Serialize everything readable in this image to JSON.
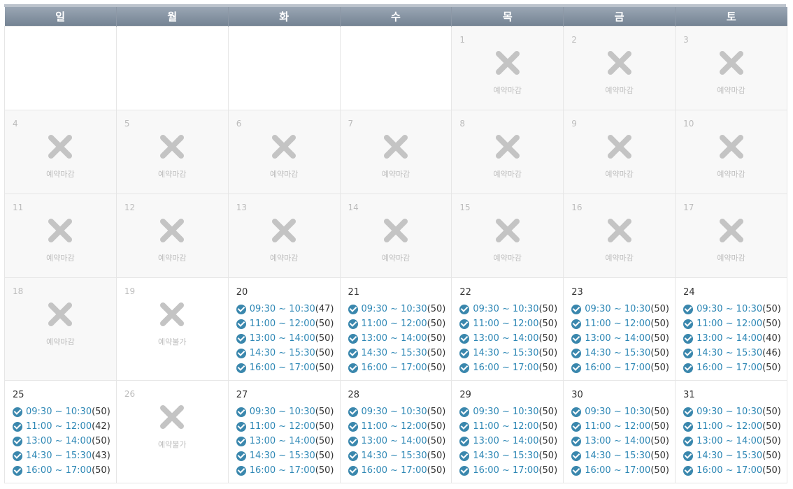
{
  "weekdays": [
    "일",
    "월",
    "화",
    "수",
    "목",
    "금",
    "토"
  ],
  "labels": {
    "closed": "예약마감",
    "unavailable": "예약불가"
  },
  "colors": {
    "header": "#7b8898",
    "slot_link": "#2d87b5",
    "check_icon": "#3a87ad",
    "closed_bg": "#f8f8f8"
  },
  "icons": {
    "closed": "x-mark-icon",
    "available": "check-circle-icon"
  },
  "weeks": [
    [
      {
        "status": "empty"
      },
      {
        "status": "empty"
      },
      {
        "status": "empty"
      },
      {
        "status": "empty"
      },
      {
        "day": "1",
        "status": "closed"
      },
      {
        "day": "2",
        "status": "closed"
      },
      {
        "day": "3",
        "status": "closed"
      }
    ],
    [
      {
        "day": "4",
        "status": "closed"
      },
      {
        "day": "5",
        "status": "closed"
      },
      {
        "day": "6",
        "status": "closed"
      },
      {
        "day": "7",
        "status": "closed"
      },
      {
        "day": "8",
        "status": "closed"
      },
      {
        "day": "9",
        "status": "closed"
      },
      {
        "day": "10",
        "status": "closed"
      }
    ],
    [
      {
        "day": "11",
        "status": "closed"
      },
      {
        "day": "12",
        "status": "closed"
      },
      {
        "day": "13",
        "status": "closed"
      },
      {
        "day": "14",
        "status": "closed"
      },
      {
        "day": "15",
        "status": "closed"
      },
      {
        "day": "16",
        "status": "closed"
      },
      {
        "day": "17",
        "status": "closed"
      }
    ],
    [
      {
        "day": "18",
        "status": "closed"
      },
      {
        "day": "19",
        "status": "unavailable"
      },
      {
        "day": "20",
        "status": "open",
        "slots": [
          {
            "time": "09:30 ~ 10:30",
            "count": "(47)"
          },
          {
            "time": "11:00 ~ 12:00",
            "count": "(50)"
          },
          {
            "time": "13:00 ~ 14:00",
            "count": "(50)"
          },
          {
            "time": "14:30 ~ 15:30",
            "count": "(50)"
          },
          {
            "time": "16:00 ~ 17:00",
            "count": "(50)"
          }
        ]
      },
      {
        "day": "21",
        "status": "open",
        "slots": [
          {
            "time": "09:30 ~ 10:30",
            "count": "(50)"
          },
          {
            "time": "11:00 ~ 12:00",
            "count": "(50)"
          },
          {
            "time": "13:00 ~ 14:00",
            "count": "(50)"
          },
          {
            "time": "14:30 ~ 15:30",
            "count": "(50)"
          },
          {
            "time": "16:00 ~ 17:00",
            "count": "(50)"
          }
        ]
      },
      {
        "day": "22",
        "status": "open",
        "slots": [
          {
            "time": "09:30 ~ 10:30",
            "count": "(50)"
          },
          {
            "time": "11:00 ~ 12:00",
            "count": "(50)"
          },
          {
            "time": "13:00 ~ 14:00",
            "count": "(50)"
          },
          {
            "time": "14:30 ~ 15:30",
            "count": "(50)"
          },
          {
            "time": "16:00 ~ 17:00",
            "count": "(50)"
          }
        ]
      },
      {
        "day": "23",
        "status": "open",
        "slots": [
          {
            "time": "09:30 ~ 10:30",
            "count": "(50)"
          },
          {
            "time": "11:00 ~ 12:00",
            "count": "(50)"
          },
          {
            "time": "13:00 ~ 14:00",
            "count": "(50)"
          },
          {
            "time": "14:30 ~ 15:30",
            "count": "(50)"
          },
          {
            "time": "16:00 ~ 17:00",
            "count": "(50)"
          }
        ]
      },
      {
        "day": "24",
        "status": "open",
        "slots": [
          {
            "time": "09:30 ~ 10:30",
            "count": "(50)"
          },
          {
            "time": "11:00 ~ 12:00",
            "count": "(50)"
          },
          {
            "time": "13:00 ~ 14:00",
            "count": "(40)"
          },
          {
            "time": "14:30 ~ 15:30",
            "count": "(46)"
          },
          {
            "time": "16:00 ~ 17:00",
            "count": "(50)"
          }
        ]
      }
    ],
    [
      {
        "day": "25",
        "status": "open",
        "slots": [
          {
            "time": "09:30 ~ 10:30",
            "count": "(50)"
          },
          {
            "time": "11:00 ~ 12:00",
            "count": "(42)"
          },
          {
            "time": "13:00 ~ 14:00",
            "count": "(50)"
          },
          {
            "time": "14:30 ~ 15:30",
            "count": "(43)"
          },
          {
            "time": "16:00 ~ 17:00",
            "count": "(50)"
          }
        ]
      },
      {
        "day": "26",
        "status": "unavailable"
      },
      {
        "day": "27",
        "status": "open",
        "slots": [
          {
            "time": "09:30 ~ 10:30",
            "count": "(50)"
          },
          {
            "time": "11:00 ~ 12:00",
            "count": "(50)"
          },
          {
            "time": "13:00 ~ 14:00",
            "count": "(50)"
          },
          {
            "time": "14:30 ~ 15:30",
            "count": "(50)"
          },
          {
            "time": "16:00 ~ 17:00",
            "count": "(50)"
          }
        ]
      },
      {
        "day": "28",
        "status": "open",
        "slots": [
          {
            "time": "09:30 ~ 10:30",
            "count": "(50)"
          },
          {
            "time": "11:00 ~ 12:00",
            "count": "(50)"
          },
          {
            "time": "13:00 ~ 14:00",
            "count": "(50)"
          },
          {
            "time": "14:30 ~ 15:30",
            "count": "(50)"
          },
          {
            "time": "16:00 ~ 17:00",
            "count": "(50)"
          }
        ]
      },
      {
        "day": "29",
        "status": "open",
        "slots": [
          {
            "time": "09:30 ~ 10:30",
            "count": "(50)"
          },
          {
            "time": "11:00 ~ 12:00",
            "count": "(50)"
          },
          {
            "time": "13:00 ~ 14:00",
            "count": "(50)"
          },
          {
            "time": "14:30 ~ 15:30",
            "count": "(50)"
          },
          {
            "time": "16:00 ~ 17:00",
            "count": "(50)"
          }
        ]
      },
      {
        "day": "30",
        "status": "open",
        "slots": [
          {
            "time": "09:30 ~ 10:30",
            "count": "(50)"
          },
          {
            "time": "11:00 ~ 12:00",
            "count": "(50)"
          },
          {
            "time": "13:00 ~ 14:00",
            "count": "(50)"
          },
          {
            "time": "14:30 ~ 15:30",
            "count": "(50)"
          },
          {
            "time": "16:00 ~ 17:00",
            "count": "(50)"
          }
        ]
      },
      {
        "day": "31",
        "status": "open",
        "slots": [
          {
            "time": "09:30 ~ 10:30",
            "count": "(50)"
          },
          {
            "time": "11:00 ~ 12:00",
            "count": "(50)"
          },
          {
            "time": "13:00 ~ 14:00",
            "count": "(50)"
          },
          {
            "time": "14:30 ~ 15:30",
            "count": "(50)"
          },
          {
            "time": "16:00 ~ 17:00",
            "count": "(50)"
          }
        ]
      }
    ]
  ]
}
